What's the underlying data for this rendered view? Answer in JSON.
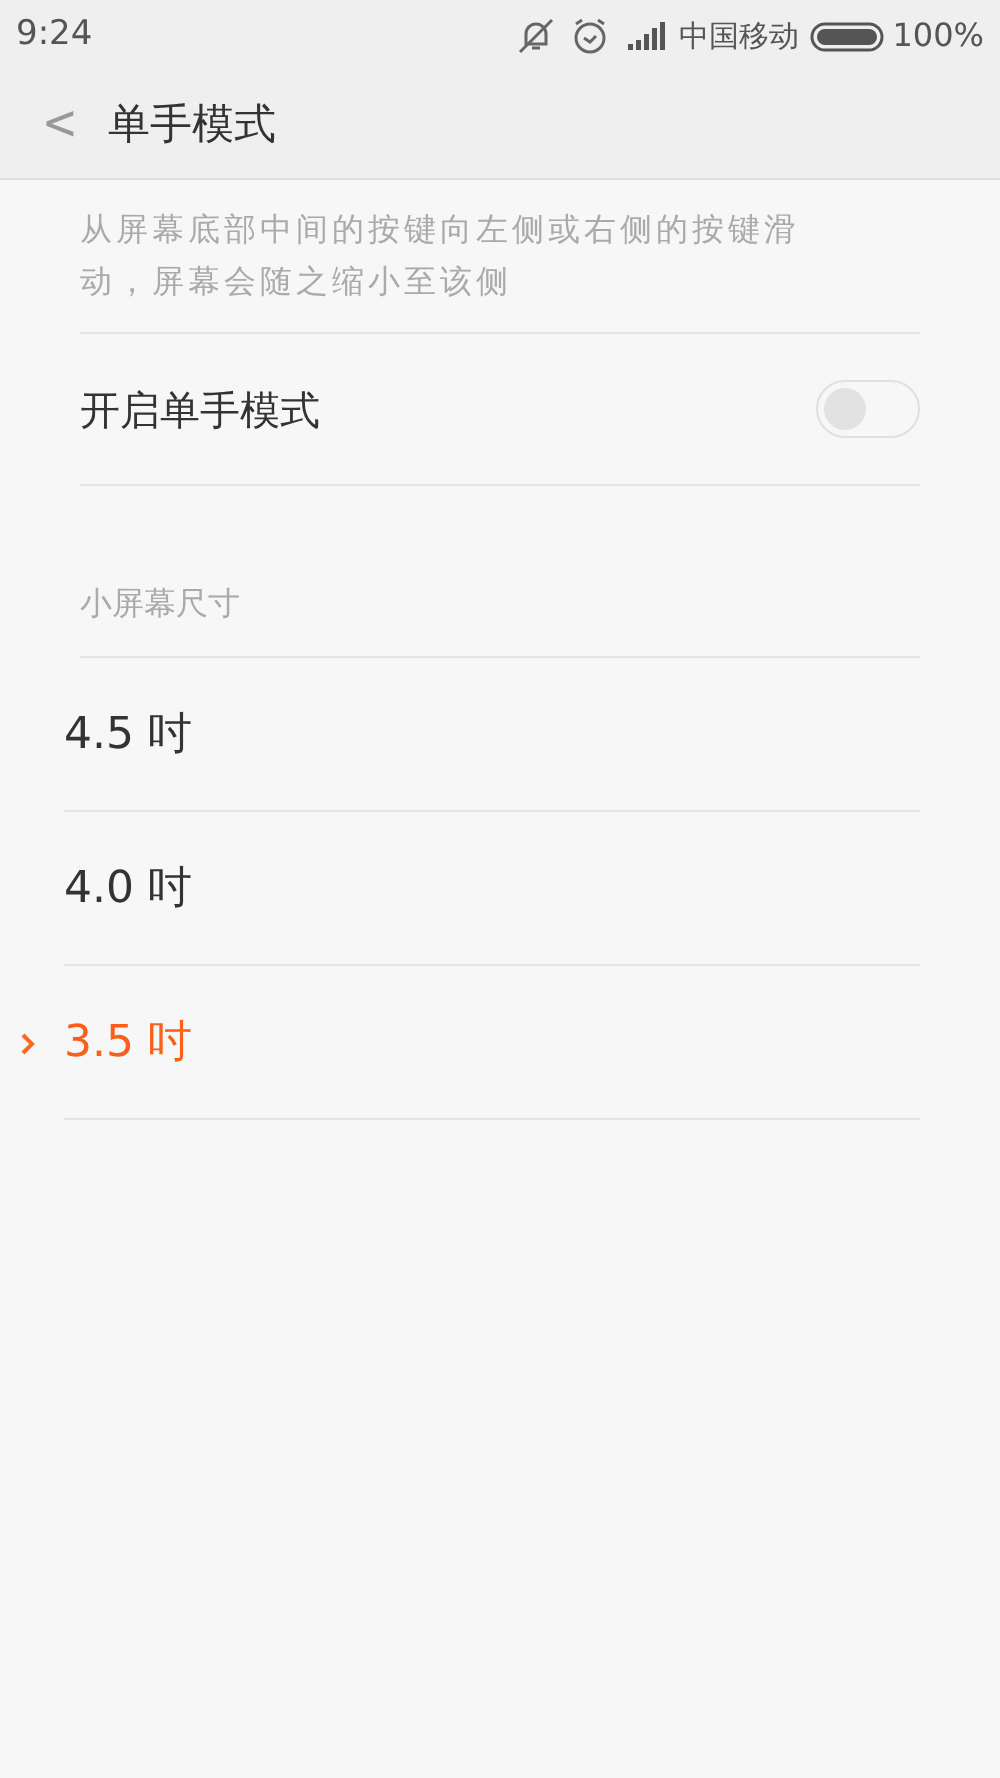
{
  "status_bar": {
    "time": "9:24",
    "carrier": "中国移动",
    "battery": "100%"
  },
  "header": {
    "back": "<",
    "title": "单手模式"
  },
  "description": "从屏幕底部中间的按键向左侧或右侧的按键滑动，屏幕会随之缩小至该侧",
  "toggle_row": {
    "label": "开启单手模式",
    "on": false
  },
  "section": {
    "title": "小屏幕尺寸"
  },
  "sizes": [
    {
      "label": "4.5 吋",
      "selected": false
    },
    {
      "label": "4.0 吋",
      "selected": false
    },
    {
      "label": "3.5 吋",
      "selected": true
    }
  ]
}
